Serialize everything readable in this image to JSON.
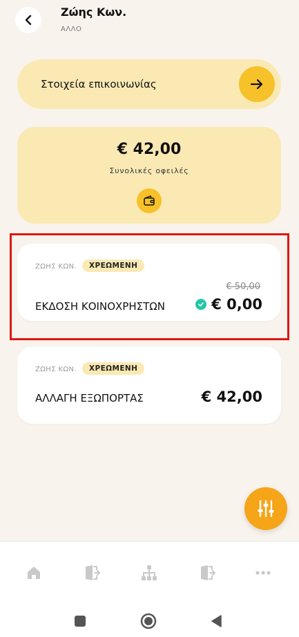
{
  "header": {
    "title": "Ζώης Κων.",
    "subtitle": "ΑΛΛΟ"
  },
  "contact": {
    "label": "Στοιχεία επικοινωνίας"
  },
  "summary": {
    "total": "€ 42,00",
    "label": "Συνολικές οφειλές"
  },
  "items": [
    {
      "owner": "ΖΩΗΣ ΚΩΝ.",
      "status": "ΧΡΕΩΜΕΝΗ",
      "name": "ΕΚΔΟΣΗ ΚΟΙΝΟΧΡΗΣΤΩΝ",
      "old_price": "€ 50,00",
      "price": "€ 0,00"
    },
    {
      "owner": "ΖΩΗΣ ΚΩΝ.",
      "status": "ΧΡΕΩΜΕΝΗ",
      "name": "ΑΛΛΑΓΗ ΕΞΩΠΟΡΤΑΣ",
      "price": "€ 42,00"
    }
  ],
  "nav": {
    "icons": [
      "home-icon",
      "door-exit-icon",
      "hierarchy-icon",
      "door-exit-icon",
      "more-icon"
    ]
  },
  "colors": {
    "background": "#f8f3ec",
    "card_yellow": "#fbe9b4",
    "accent_yellow": "#f7c12a",
    "fab_orange": "#f6a418",
    "check_green": "#22c7a6",
    "highlight_red": "#e01515"
  }
}
